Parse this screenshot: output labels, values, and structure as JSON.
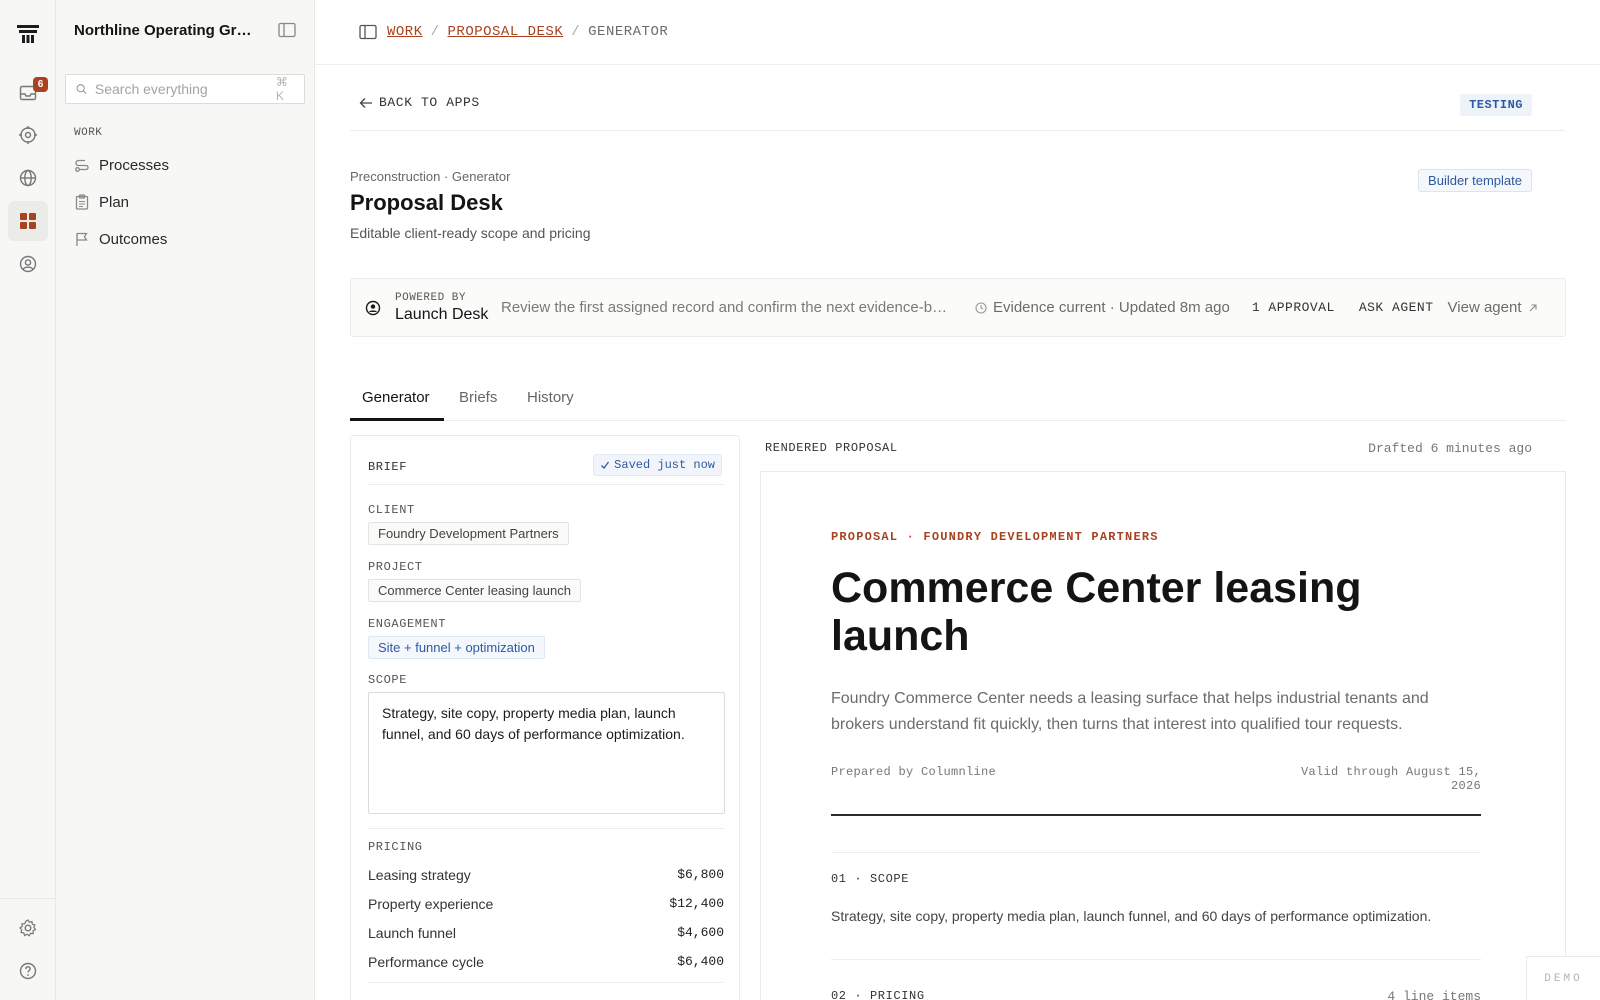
{
  "rail": {
    "inbox_badge": "6"
  },
  "sidebar": {
    "org_name": "Northline Operating Gro...",
    "search_placeholder": "Search everything",
    "search_shortcut": "⌘ K",
    "section_label": "WORK",
    "items": [
      {
        "label": "Processes",
        "icon": "route-icon"
      },
      {
        "label": "Plan",
        "icon": "clipboard-icon"
      },
      {
        "label": "Outcomes",
        "icon": "flag-icon"
      }
    ]
  },
  "breadcrumb": {
    "items": [
      "WORK",
      "PROPOSAL_DESK"
    ],
    "separator": "/",
    "current": "GENERATOR"
  },
  "header": {
    "back_label": "BACK TO APPS",
    "status_badge": "TESTING",
    "eyebrow": "Preconstruction · Generator",
    "title": "Proposal Desk",
    "subtitle": "Editable client-ready scope and pricing",
    "template_chip": "Builder template"
  },
  "agent_bar": {
    "powered_by_label": "POWERED BY",
    "agent_name": "Launch Desk",
    "message": "Review the first assigned record and confirm the next evidence-backed step.",
    "evidence_status": "Evidence current · Updated 8m ago",
    "approval": "1 APPROVAL",
    "ask_agent": "ASK AGENT",
    "view_agent": "View agent"
  },
  "tabs": [
    {
      "label": "Generator",
      "active": true
    },
    {
      "label": "Briefs",
      "active": false
    },
    {
      "label": "History",
      "active": false
    }
  ],
  "brief": {
    "heading": "BRIEF",
    "saved_status": "Saved just now",
    "client_label": "CLIENT",
    "client_value": "Foundry Development Partners",
    "project_label": "PROJECT",
    "project_value": "Commerce Center leasing launch",
    "engagement_label": "ENGAGEMENT",
    "engagement_value": "Site + funnel + optimization",
    "scope_label": "SCOPE",
    "scope_value": "Strategy, site copy, property media plan, launch funnel, and 60 days of performance optimization.",
    "pricing_label": "PRICING",
    "pricing": [
      {
        "label": "Leasing strategy",
        "value": "$6,800"
      },
      {
        "label": "Property experience",
        "value": "$12,400"
      },
      {
        "label": "Launch funnel",
        "value": "$4,600"
      },
      {
        "label": "Performance cycle",
        "value": "$6,400"
      }
    ]
  },
  "proposal": {
    "heading": "RENDERED PROPOSAL",
    "drafted": "Drafted 6 minutes ago",
    "eyebrow": "PROPOSAL · FOUNDRY DEVELOPMENT PARTNERS",
    "title": "Commerce Center leasing launch",
    "summary": "Foundry Commerce Center needs a leasing surface that helps industrial tenants and brokers understand fit quickly, then turns that interest into qualified tour requests.",
    "prepared_by": "Prepared by Columnline",
    "valid_through": "Valid through August 15, 2026",
    "section1_label": "01 · SCOPE",
    "section1_text": "Strategy, site copy, property media plan, launch funnel, and 60 days of performance optimization.",
    "section2_label": "02 · PRICING",
    "section2_count": "4 line items"
  },
  "demo_label": "DEMO",
  "colors": {
    "accent": "#a8431f",
    "blue": "#2d5a9e"
  }
}
